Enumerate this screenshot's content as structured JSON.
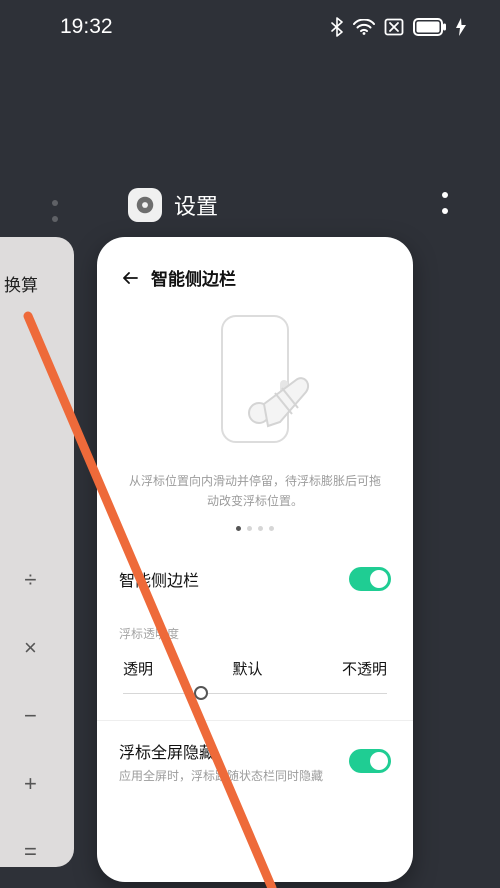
{
  "status_bar": {
    "time": "19:32"
  },
  "recents": {
    "app_title": "设置",
    "prev_app": {
      "title": "换算",
      "operators": [
        "÷",
        "×",
        "−",
        "+",
        "="
      ]
    }
  },
  "settings_card": {
    "page_title": "智能侧边栏",
    "illustration_caption": "从浮标位置向内滑动并停留，待浮标膨胀后可拖动改变浮标位置。",
    "sidebar_toggle_label": "智能侧边栏",
    "opacity_section_label": "浮标透明度",
    "opacity_options": {
      "transparent": "透明",
      "default": "默认",
      "opaque": "不透明"
    },
    "fullscreen_hide": {
      "title": "浮标全屏隐藏",
      "subtitle": "应用全屏时，浮标跟随状态栏同时隐藏"
    }
  }
}
